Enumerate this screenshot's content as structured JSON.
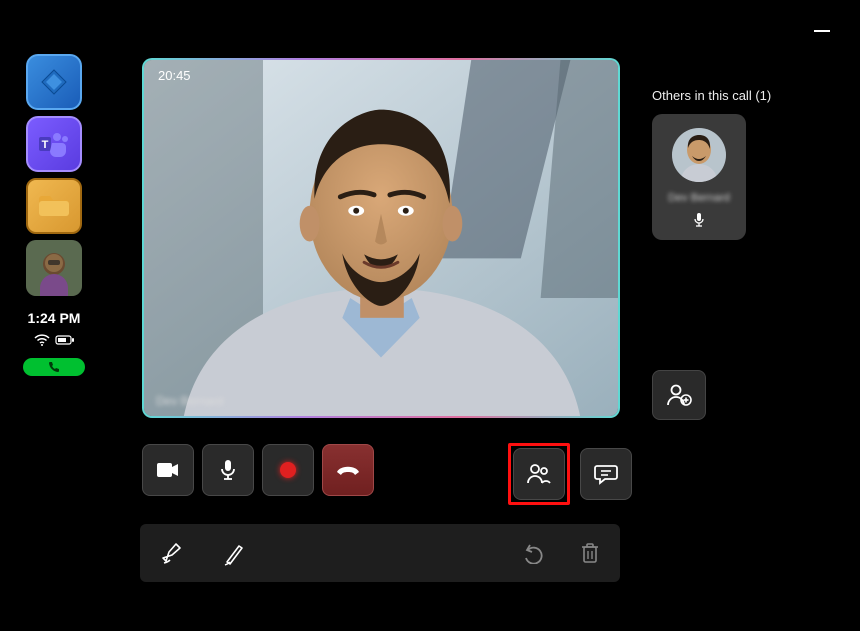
{
  "window": {
    "minimize_label": "Minimize"
  },
  "sidebar": {
    "apps": [
      {
        "name": "app-launcher"
      },
      {
        "name": "teams"
      },
      {
        "name": "files"
      },
      {
        "name": "contact-avatar"
      }
    ],
    "time": "1:24 PM",
    "call_status": "active"
  },
  "call": {
    "elapsed_time": "20:45",
    "speaker_name": "Dev Bernard"
  },
  "others": {
    "header": "Others in this call (1)",
    "participants": [
      {
        "name": "Dev Bernard",
        "muted": false
      }
    ]
  },
  "controls": {
    "camera": "Camera",
    "mic": "Microphone",
    "record": "Record",
    "hangup": "Hang up",
    "people": "People",
    "chat": "Chat",
    "add_participant": "Add participant"
  },
  "annotation_toolbar": {
    "highlighter": "Highlighter",
    "pen": "Pen",
    "undo": "Undo",
    "delete": "Delete"
  }
}
